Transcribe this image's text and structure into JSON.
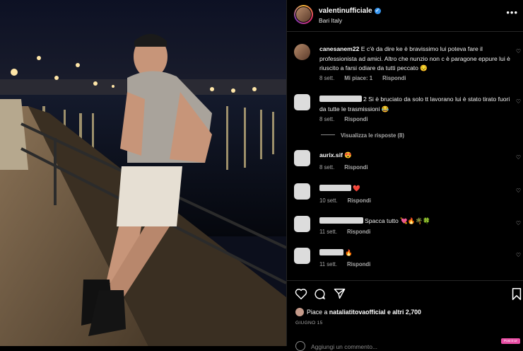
{
  "post": {
    "username": "valentinufficiale",
    "location": "Bari Italy",
    "more_icon": "more-horizontal-icon",
    "verified_icon": "verified-badge-icon"
  },
  "comments": [
    {
      "user": "canesanem22",
      "text": "E c'è da dire ke è bravissimo lui poteva fare il professionista ad amici. Altro che nunzio non c è paragone eppure lui è riuscito a farsi odiare da tutti peccato 😔",
      "time": "8 sett.",
      "likes": "Mi piace: 1",
      "reply": "Rispondi"
    },
    {
      "user": "",
      "text": "2 Si è bruciato da solo tt lavorano lui è stato tirato fuori da tutte le trasmissioni 😂",
      "time": "8 sett.",
      "reply": "Rispondi"
    },
    {
      "user": "aurix.sif",
      "text": "😍",
      "time": "8 sett.",
      "reply": "Rispondi"
    },
    {
      "user": "",
      "text": "❤️",
      "time": "10 sett.",
      "reply": "Rispondi"
    },
    {
      "user": "",
      "text": "Spacca tutto 💘🔥🌴🍀",
      "time": "11 sett.",
      "reply": "Rispondi"
    },
    {
      "user": "",
      "text": "🔥",
      "time": "11 sett.",
      "reply": "Rispondi"
    }
  ],
  "view_replies": "Visualizza le risposte (8)",
  "actions": {
    "like_icon": "heart-outline-icon",
    "comment_icon": "comment-bubble-icon",
    "share_icon": "paper-plane-icon",
    "save_icon": "bookmark-icon"
  },
  "likes": {
    "prefix": "Piace a",
    "user": "nataliatitovaofficial",
    "suffix": "e altri 2,700"
  },
  "date": "GIUGNO 15",
  "add_comment": "Aggiungi un commento...",
  "badge": "Post it Ur"
}
